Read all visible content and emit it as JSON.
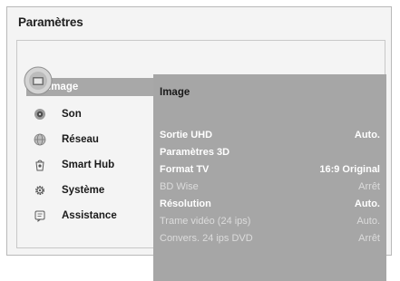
{
  "window": {
    "title": "Paramètres"
  },
  "menu": {
    "items": [
      {
        "label": "Image",
        "icon": "picture-icon",
        "selected": true
      },
      {
        "label": "Son",
        "icon": "sound-icon",
        "selected": false
      },
      {
        "label": "Réseau",
        "icon": "network-icon",
        "selected": false
      },
      {
        "label": "Smart Hub",
        "icon": "smart-hub-icon",
        "selected": false
      },
      {
        "label": "Système",
        "icon": "system-gear-icon",
        "selected": false
      },
      {
        "label": "Assistance",
        "icon": "support-icon",
        "selected": false
      }
    ]
  },
  "panel": {
    "heading": "Image",
    "rows": [
      {
        "label": "Sortie UHD",
        "value": "Auto.",
        "enabled": true
      },
      {
        "label": "Paramètres 3D",
        "value": "",
        "enabled": true
      },
      {
        "label": "Format TV",
        "value": "16:9 Original",
        "enabled": true
      },
      {
        "label": "BD Wise",
        "value": "Arrêt",
        "enabled": false
      },
      {
        "label": "Résolution",
        "value": "Auto.",
        "enabled": true
      },
      {
        "label": "Trame vidéo (24 ips)",
        "value": "Auto.",
        "enabled": false
      },
      {
        "label": "Convers. 24 ips DVD",
        "value": "Arrêt",
        "enabled": false
      }
    ]
  },
  "colors": {
    "panel_bg": "#a6a6a6",
    "selected_bg": "#a8a8a8",
    "enabled_text": "#ffffff",
    "disabled_text": "#dcdcdc"
  }
}
